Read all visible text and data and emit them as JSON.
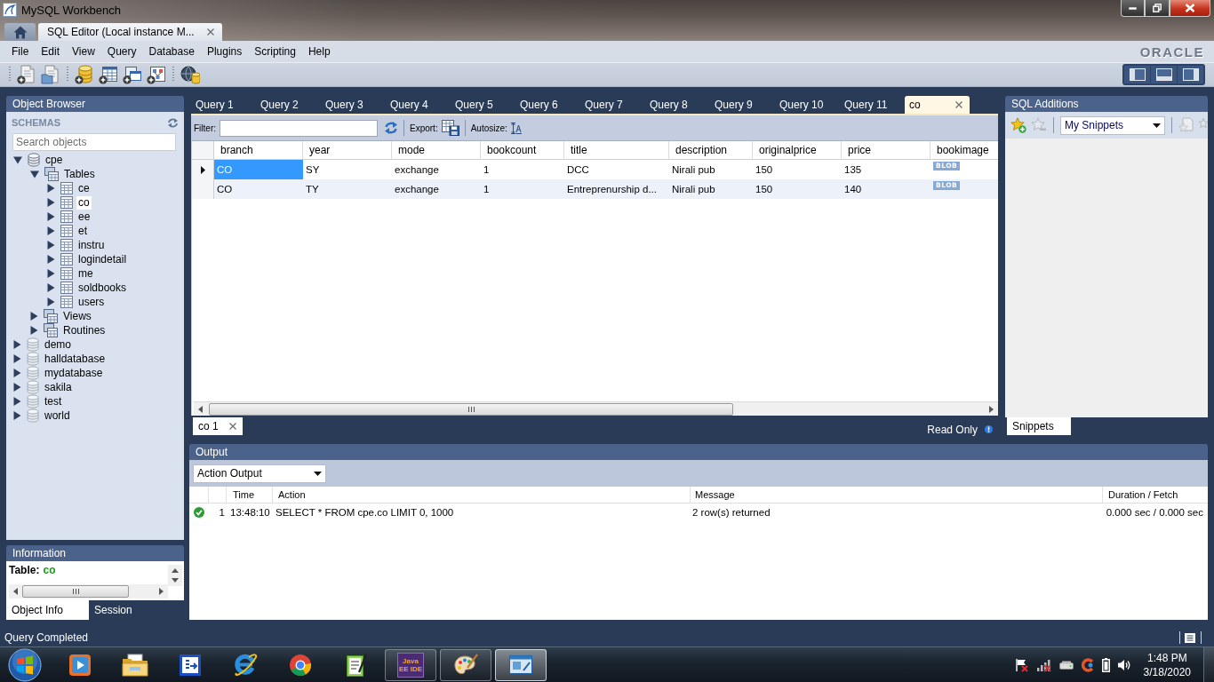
{
  "window": {
    "title": "MySQL Workbench"
  },
  "app_tabs": [
    {
      "kind": "home",
      "selected": false
    },
    {
      "kind": "editor",
      "label": "SQL Editor (Local instance M...",
      "selected": true
    }
  ],
  "menu": [
    "File",
    "Edit",
    "View",
    "Query",
    "Database",
    "Plugins",
    "Scripting",
    "Help"
  ],
  "brand": "ORACLE",
  "panel_toggles": [
    {
      "kind": "left",
      "on": true
    },
    {
      "kind": "bottom",
      "on": true
    },
    {
      "kind": "right",
      "on": true
    }
  ],
  "object_browser": {
    "title": "Object Browser",
    "section": "SCHEMAS",
    "search": {
      "placeholder": "Search objects"
    },
    "tree": [
      {
        "label": "cpe",
        "kind": "schema",
        "expanded": true,
        "selected": false,
        "children": [
          {
            "label": "Tables",
            "kind": "folder",
            "expanded": true,
            "selected": false,
            "children": [
              {
                "label": "ce",
                "kind": "table",
                "expanded": false,
                "selected": false
              },
              {
                "label": "co",
                "kind": "table",
                "expanded": false,
                "selected": true
              },
              {
                "label": "ee",
                "kind": "table",
                "expanded": false,
                "selected": false
              },
              {
                "label": "et",
                "kind": "table",
                "expanded": false,
                "selected": false
              },
              {
                "label": "instru",
                "kind": "table",
                "expanded": false,
                "selected": false
              },
              {
                "label": "logindetail",
                "kind": "table",
                "expanded": false,
                "selected": false
              },
              {
                "label": "me",
                "kind": "table",
                "expanded": false,
                "selected": false
              },
              {
                "label": "soldbooks",
                "kind": "table",
                "expanded": false,
                "selected": false
              },
              {
                "label": "users",
                "kind": "table",
                "expanded": false,
                "selected": false
              }
            ]
          },
          {
            "label": "Views",
            "kind": "folder",
            "expanded": false,
            "selected": false
          },
          {
            "label": "Routines",
            "kind": "folder",
            "expanded": false,
            "selected": false
          }
        ]
      },
      {
        "label": "demo",
        "kind": "schema",
        "expanded": false,
        "selected": false
      },
      {
        "label": "halldatabase",
        "kind": "schema",
        "expanded": false,
        "selected": false
      },
      {
        "label": "mydatabase",
        "kind": "schema",
        "expanded": false,
        "selected": false
      },
      {
        "label": "sakila",
        "kind": "schema",
        "expanded": false,
        "selected": false
      },
      {
        "label": "test",
        "kind": "schema",
        "expanded": false,
        "selected": false
      },
      {
        "label": "world",
        "kind": "schema",
        "expanded": false,
        "selected": false
      }
    ]
  },
  "information": {
    "title": "Information",
    "label": "Table:",
    "value": "co",
    "tabs": [
      {
        "label": "Object Info",
        "selected": true
      },
      {
        "label": "Session",
        "selected": false
      }
    ]
  },
  "query_tabs": [
    {
      "label": "Query 1",
      "selected": false,
      "closable": false
    },
    {
      "label": "Query 2",
      "selected": false,
      "closable": false
    },
    {
      "label": "Query 3",
      "selected": false,
      "closable": false
    },
    {
      "label": "Query 4",
      "selected": false,
      "closable": false
    },
    {
      "label": "Query 5",
      "selected": false,
      "closable": false
    },
    {
      "label": "Query 6",
      "selected": false,
      "closable": false
    },
    {
      "label": "Query 7",
      "selected": false,
      "closable": false
    },
    {
      "label": "Query 8",
      "selected": false,
      "closable": false
    },
    {
      "label": "Query 9",
      "selected": false,
      "closable": false
    },
    {
      "label": "Query 10",
      "selected": false,
      "closable": false
    },
    {
      "label": "Query 11",
      "selected": false,
      "closable": false
    },
    {
      "label": "co",
      "selected": true,
      "closable": true
    }
  ],
  "result_toolbar": {
    "filter_label": "Filter:",
    "export_label": "Export:",
    "autosize_label": "Autosize:"
  },
  "grid": {
    "columns": [
      "branch",
      "year",
      "mode",
      "bookcount",
      "title",
      "description",
      "originalprice",
      "price",
      "bookimage"
    ],
    "rows": [
      {
        "current": true,
        "cells": [
          {
            "kind": "text",
            "value": "CO",
            "selected": true
          },
          {
            "kind": "text",
            "value": "SY",
            "selected": false
          },
          {
            "kind": "text",
            "value": "exchange",
            "selected": false
          },
          {
            "kind": "text",
            "value": "1",
            "selected": false
          },
          {
            "kind": "text",
            "value": "DCC",
            "selected": false
          },
          {
            "kind": "text",
            "value": "Nirali pub",
            "selected": false
          },
          {
            "kind": "text",
            "value": "150",
            "selected": false
          },
          {
            "kind": "text",
            "value": "135",
            "selected": false
          },
          {
            "kind": "blob",
            "value": "BLOB",
            "selected": false
          }
        ]
      },
      {
        "current": false,
        "cells": [
          {
            "kind": "text",
            "value": "CO",
            "selected": false
          },
          {
            "kind": "text",
            "value": "TY",
            "selected": false
          },
          {
            "kind": "text",
            "value": "exchange",
            "selected": false
          },
          {
            "kind": "text",
            "value": "1",
            "selected": false
          },
          {
            "kind": "text",
            "value": "Entreprenurship d...",
            "selected": false
          },
          {
            "kind": "text",
            "value": "Nirali pub",
            "selected": false
          },
          {
            "kind": "text",
            "value": "150",
            "selected": false
          },
          {
            "kind": "text",
            "value": "140",
            "selected": false
          },
          {
            "kind": "blob",
            "value": "BLOB",
            "selected": false
          }
        ]
      }
    ]
  },
  "result_tabs": [
    {
      "label": "co 1",
      "selected": true,
      "closable": true
    }
  ],
  "read_only": "Read Only",
  "sql_additions": {
    "title": "SQL Additions",
    "dropdown": "My Snippets",
    "tabs": [
      {
        "label": "Snippets",
        "selected": true
      }
    ]
  },
  "output": {
    "title": "Output",
    "dropdown": "Action Output",
    "columns": [
      "Time",
      "Action",
      "Message",
      "Duration / Fetch"
    ],
    "rows": [
      {
        "kind": "success",
        "number": "1",
        "time": "13:48:10",
        "action": "SELECT * FROM cpe.co LIMIT 0, 1000",
        "message": "2 row(s) returned",
        "duration": "0.000 sec / 0.000 sec"
      }
    ]
  },
  "status_bar": {
    "text": "Query Completed"
  },
  "taskbar": {
    "apps": [
      {
        "kind": "media",
        "running": false,
        "selected": false
      },
      {
        "kind": "explorer",
        "running": false,
        "selected": false
      },
      {
        "kind": "blue_app",
        "running": false,
        "selected": false
      },
      {
        "kind": "ie",
        "running": false,
        "selected": false
      },
      {
        "kind": "chrome",
        "running": false,
        "selected": false
      },
      {
        "kind": "notepad",
        "running": false,
        "selected": false
      },
      {
        "kind": "eclipse",
        "label": "Java EE IDE",
        "running": true,
        "selected": false
      },
      {
        "kind": "paint",
        "running": true,
        "selected": false
      },
      {
        "kind": "workbench",
        "running": true,
        "selected": true
      }
    ],
    "clock": {
      "time": "1:48 PM",
      "date": "3/18/2020"
    }
  }
}
